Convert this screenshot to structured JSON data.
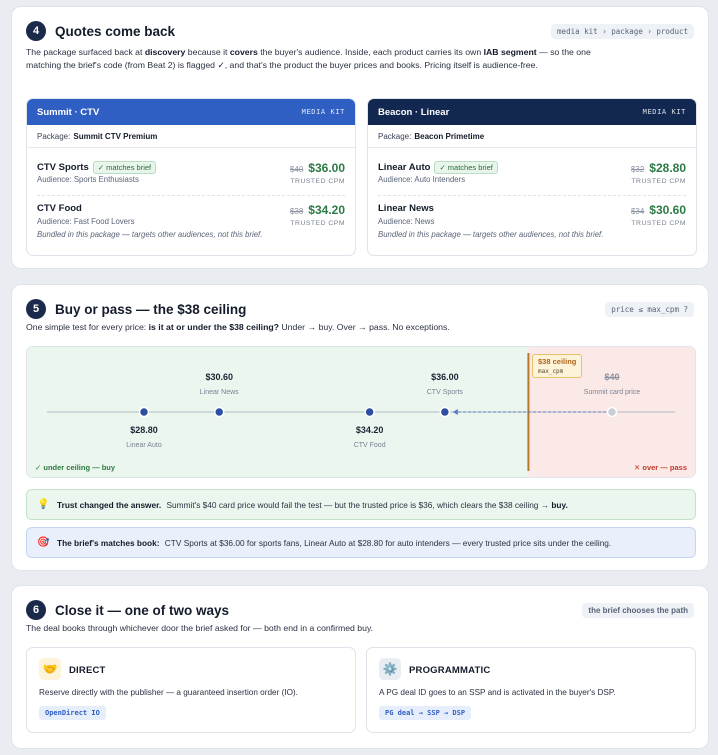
{
  "s4": {
    "num": "4",
    "title": "Quotes come back",
    "tag": "media kit › package › product",
    "desc": [
      {
        "t": "The package surfaced back at "
      },
      {
        "t": "discovery",
        "b": true
      },
      {
        "t": " because it "
      },
      {
        "t": "covers",
        "b": true
      },
      {
        "t": " the buyer's audience. Inside, each product carries its own "
      },
      {
        "t": "IAB segment",
        "b": true
      },
      {
        "t": " — so the one matching the brief's code (from Beat 2) is flagged "
      },
      {
        "t": "✓",
        "b": true
      },
      {
        "t": ", and that's the product the buyer prices and books. Pricing itself is audience-free."
      }
    ],
    "kits": [
      {
        "name": "Summit · CTV",
        "tag": "MEDIA KIT",
        "pkg_label": "Package:",
        "pkg_name": "Summit CTV Premium",
        "products": [
          {
            "name": "CTV Sports",
            "match": "✓ matches brief",
            "audience": "Audience: Sports Enthusiasts",
            "card": "$40",
            "trusted": "$36.00",
            "cap": "TRUSTED CPM",
            "note": ""
          },
          {
            "name": "CTV Food",
            "match": "",
            "audience": "Audience: Fast Food Lovers",
            "card": "$38",
            "trusted": "$34.20",
            "cap": "TRUSTED CPM",
            "note": "Bundled in this package — targets other audiences, not this brief."
          }
        ]
      },
      {
        "name": "Beacon · Linear",
        "tag": "MEDIA KIT",
        "pkg_label": "Package:",
        "pkg_name": "Beacon Primetime",
        "products": [
          {
            "name": "Linear Auto",
            "match": "✓ matches brief",
            "audience": "Audience: Auto Intenders",
            "card": "$32",
            "trusted": "$28.80",
            "cap": "TRUSTED CPM",
            "note": ""
          },
          {
            "name": "Linear News",
            "match": "",
            "audience": "Audience: News",
            "card": "$34",
            "trusted": "$30.60",
            "cap": "TRUSTED CPM",
            "note": "Bundled in this package — targets other audiences, not this brief."
          }
        ]
      }
    ]
  },
  "s5": {
    "num": "5",
    "title": "Buy or pass — the $38 ceiling",
    "tag": "price ≤ max_cpm ?",
    "desc": [
      {
        "t": "One simple test for every price: "
      },
      {
        "t": "is it at or under the $38 ceiling?",
        "b": true
      },
      {
        "t": " Under → buy. Over → pass. No exceptions."
      }
    ],
    "under_label": "✓ under ceiling — buy",
    "over_label": "✕ over — pass",
    "ceiling_title": "$38 ceiling",
    "ceiling_code": "max_cpm",
    "colors": {
      "under_bg": "#ebf6ee",
      "over_bg": "#fbe9e7",
      "ceiling": "#b8782a",
      "dot": "#2d4fa1",
      "ghost": "#c9cdd6"
    },
    "chart_data": {
      "type": "scatter",
      "ceiling": 38,
      "points": [
        {
          "value": 28.8,
          "label": "$28.80",
          "name": "Linear Auto",
          "pos": "below"
        },
        {
          "value": 30.6,
          "label": "$30.60",
          "name": "Linear News",
          "pos": "above"
        },
        {
          "value": 34.2,
          "label": "$34.20",
          "name": "CTV Food",
          "pos": "below"
        },
        {
          "value": 36.0,
          "label": "$36.00",
          "name": "CTV Sports",
          "pos": "above"
        },
        {
          "value": 40,
          "label": "$40",
          "name": "Summit card price",
          "pos": "above",
          "ghost": true
        }
      ],
      "arrow": {
        "from": 40,
        "to": 36
      }
    },
    "notes": [
      {
        "icon": "💡",
        "bold": "Trust changed the answer.",
        "text": "Summit's $40 card price would fail the test — but the trusted price is $36, which clears the $38 ceiling →",
        "tail": "buy."
      },
      {
        "icon": "🎯",
        "bold": "The brief's matches book:",
        "text": "CTV Sports at $36.00 for sports fans, Linear Auto at $28.80 for auto intenders — every trusted price sits under the ceiling.",
        "tail": ""
      }
    ]
  },
  "s6": {
    "num": "6",
    "title": "Close it — one of two ways",
    "tag": "the brief chooses the path",
    "desc": [
      {
        "t": "The deal books through whichever door the brief asked for — both end in a confirmed buy."
      }
    ],
    "options": [
      {
        "icon": "🤝",
        "title": "DIRECT",
        "desc": "Reserve directly with the publisher — a guaranteed insertion order (IO).",
        "chip": "OpenDirect IO"
      },
      {
        "icon": "⚙️",
        "title": "PROGRAMMATIC",
        "desc": "A PG deal ID goes to an SSP and is activated in the buyer's DSP.",
        "chip": "PG deal → SSP → DSP"
      }
    ]
  }
}
